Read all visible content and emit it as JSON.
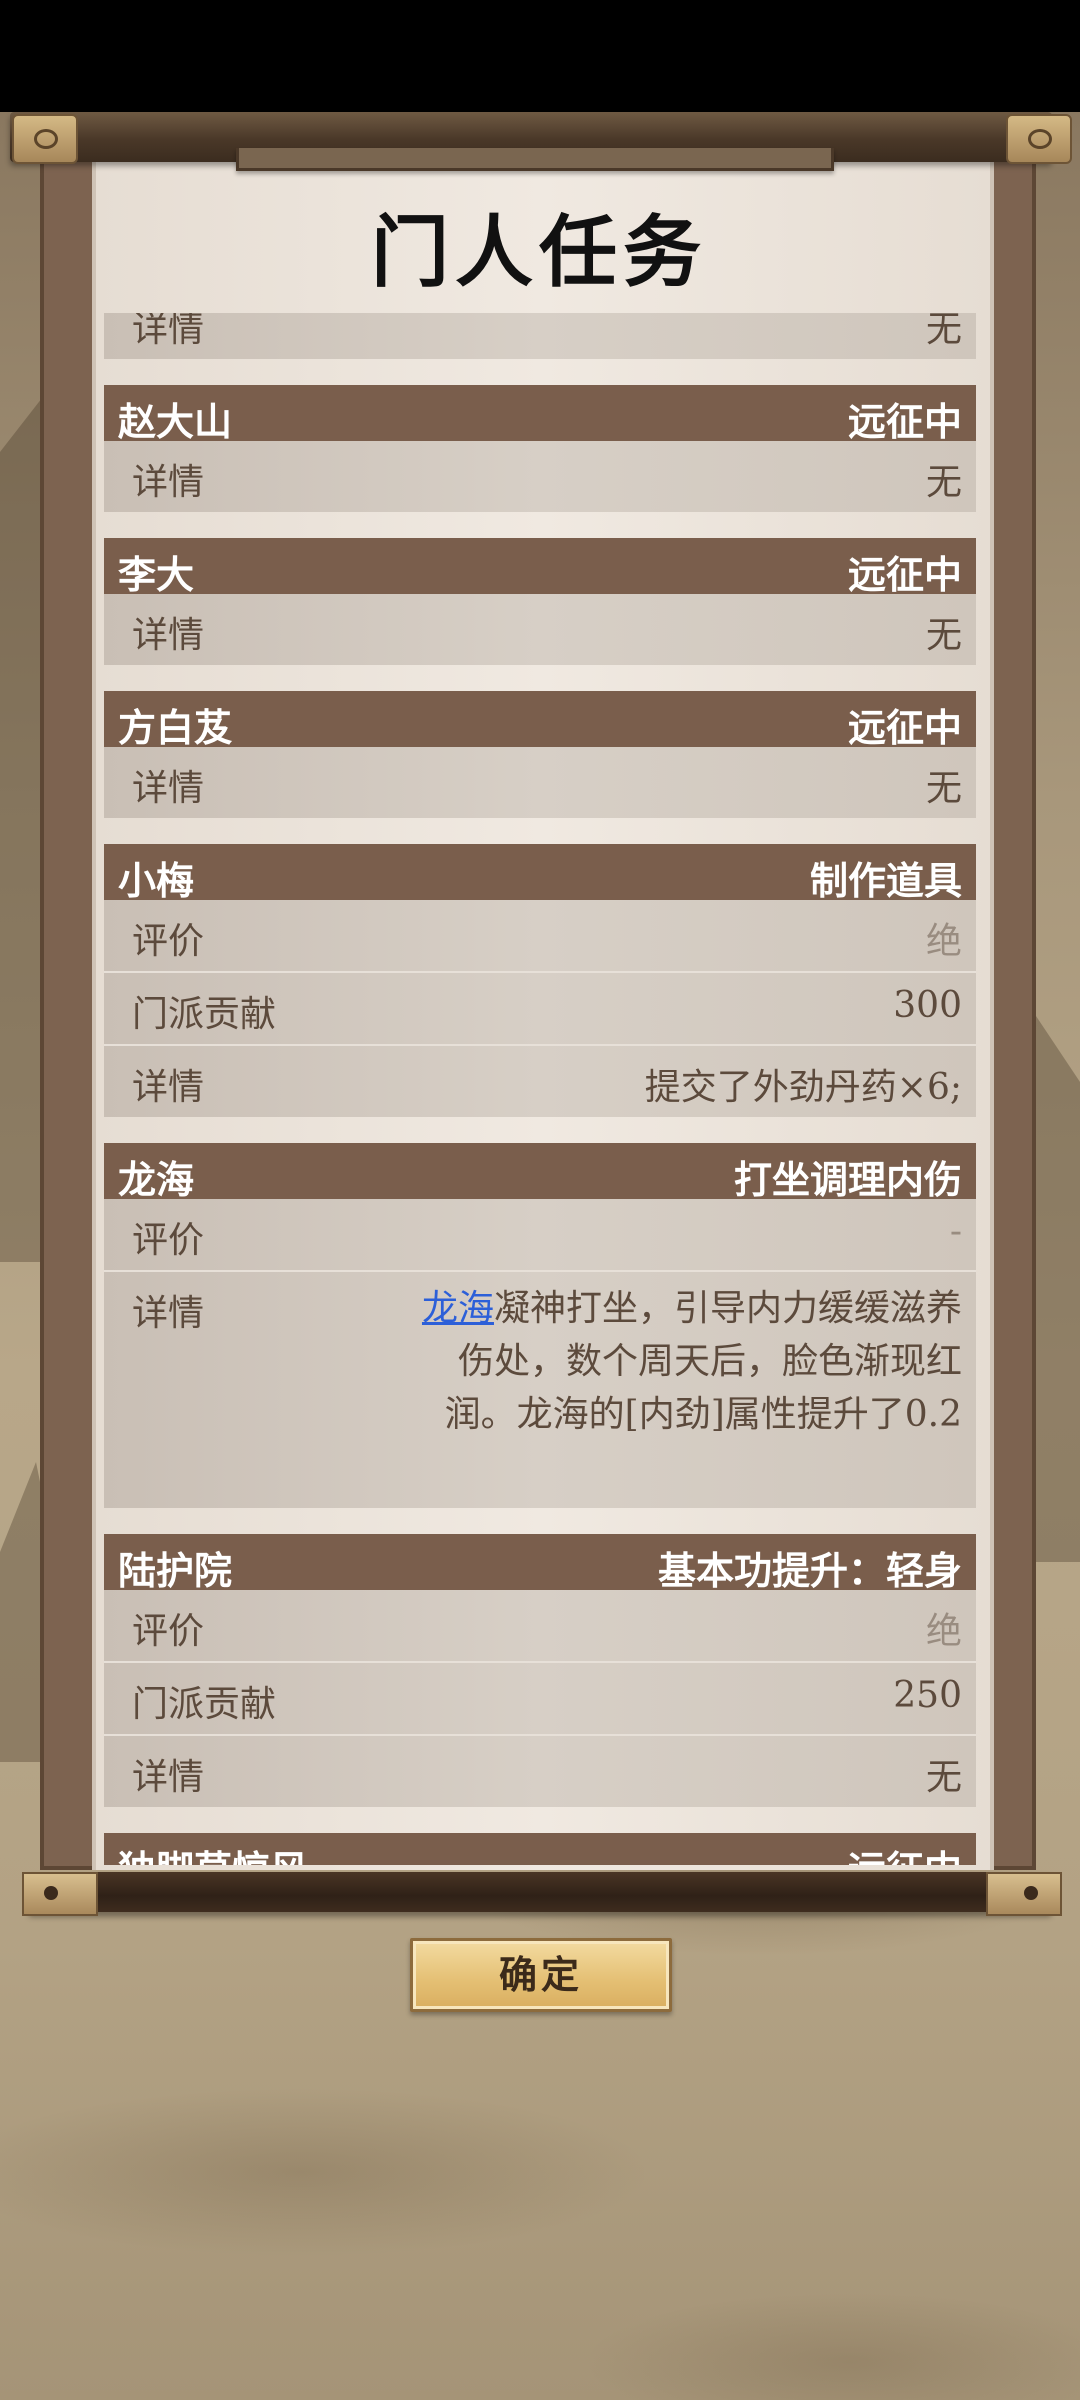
{
  "title": "门人任务",
  "entries": [
    {
      "rows": [
        {
          "label": "详情",
          "value": "无"
        }
      ]
    },
    {
      "name": "赵大山",
      "status": "远征中",
      "rows": [
        {
          "label": "详情",
          "value": "无"
        }
      ]
    },
    {
      "name": "李大",
      "status": "远征中",
      "rows": [
        {
          "label": "详情",
          "value": "无"
        }
      ]
    },
    {
      "name": "方白芨",
      "status": "远征中",
      "rows": [
        {
          "label": "详情",
          "value": "无"
        }
      ]
    },
    {
      "name": "小梅",
      "status": "制作道具",
      "rows": [
        {
          "label": "评价",
          "value": "绝"
        },
        {
          "label": "门派贡献",
          "value": "300"
        },
        {
          "label": "详情",
          "value": "提交了外劲丹药×6;"
        }
      ]
    },
    {
      "name": "龙海",
      "status": "打坐调理内伤",
      "rows": [
        {
          "label": "评价",
          "value": "-"
        },
        {
          "label": "详情",
          "highlight": "龙海",
          "value": "凝神打坐，引导内力缓缓滋养伤处，数个周天后，脸色渐现红润。龙海的[内劲]属性提升了0.2"
        }
      ]
    },
    {
      "name": "陆护院",
      "status": "基本功提升：轻身",
      "rows": [
        {
          "label": "评价",
          "value": "绝"
        },
        {
          "label": "门派贡献",
          "value": "250"
        },
        {
          "label": "详情",
          "value": "无"
        }
      ]
    },
    {
      "name": "独脚草惊风",
      "status": "远征中"
    }
  ],
  "confirm_button": "确定"
}
